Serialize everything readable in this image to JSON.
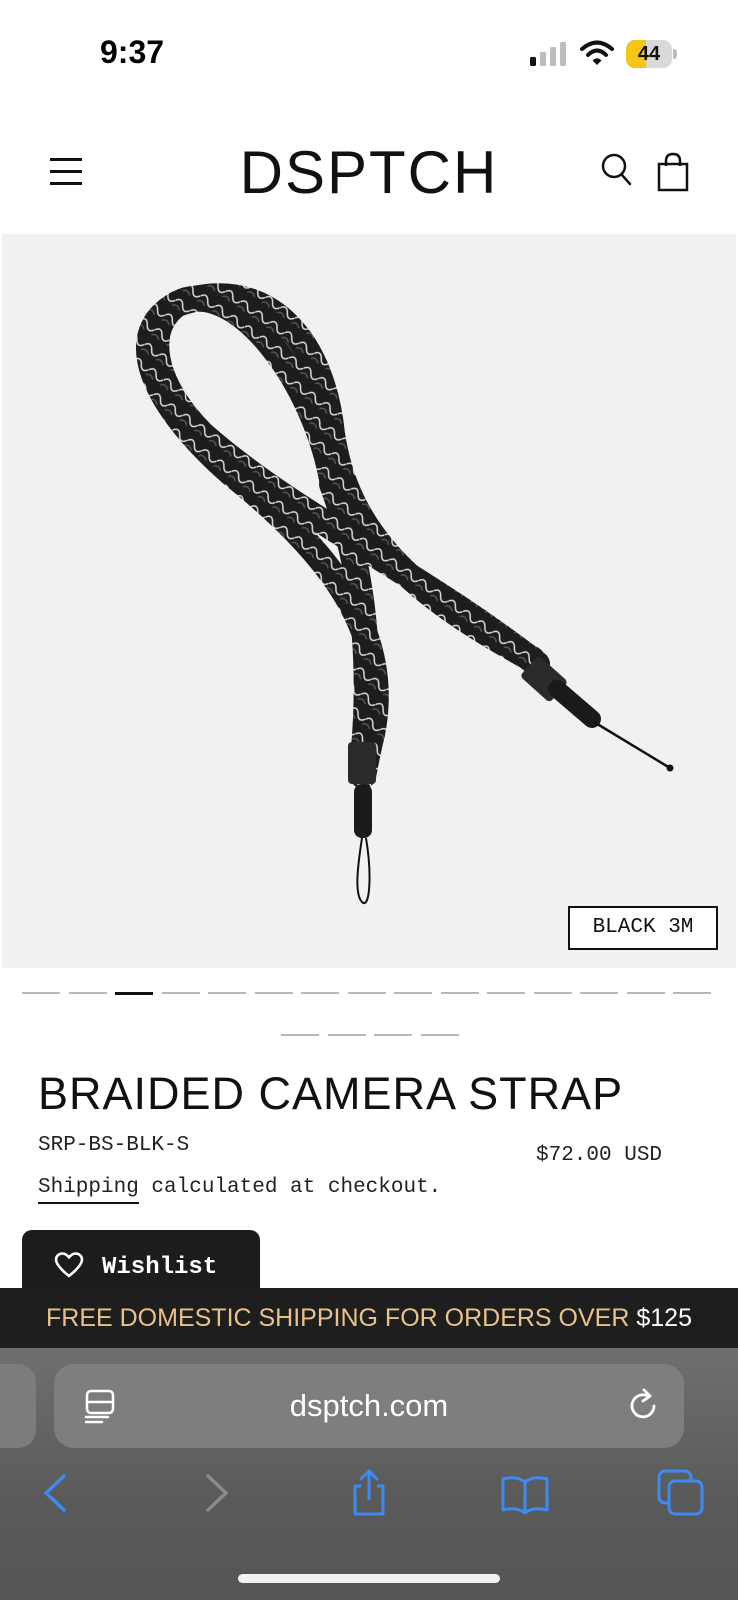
{
  "status_bar": {
    "time": "9:37",
    "battery_level": "44",
    "battery_fraction": 0.44,
    "battery_color": "#f5c518",
    "signal_icon": "cellular-signal-icon",
    "wifi_icon": "wifi-icon"
  },
  "header": {
    "logo": "DSPTCH",
    "menu_icon": "hamburger-menu-icon",
    "search_icon": "search-icon",
    "cart_icon": "shopping-bag-icon"
  },
  "product": {
    "image_icon": "braided-camera-strap-photo",
    "variant_badge": "BLACK 3M",
    "title": "BRAIDED CAMERA STRAP",
    "sku": "SRP-BS-BLK-S",
    "price": "$72.00 USD",
    "shipping_link": "Shipping",
    "shipping_note": " calculated at checkout.",
    "wishlist_label": "Wishlist",
    "wishlist_icon": "heart-outline-icon"
  },
  "carousel": {
    "total_slides": 19,
    "active_index": 2
  },
  "promo": {
    "text": "FREE DOMESTIC SHIPPING FOR ORDERS OVER",
    "amount": "$125",
    "text_color": "#e8c28a"
  },
  "browser": {
    "url": "dsptch.com",
    "reader_icon": "reader-mode-icon",
    "reload_icon": "reload-icon",
    "toolbar": [
      "back-icon",
      "forward-icon",
      "share-icon",
      "bookmarks-icon",
      "tabs-icon"
    ],
    "accent": "#3d8bf2"
  }
}
